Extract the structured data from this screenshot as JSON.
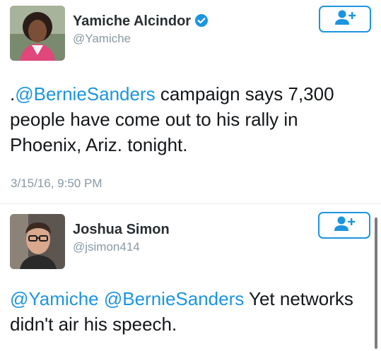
{
  "tweets": [
    {
      "author_name": "Yamiche Alcindor",
      "author_handle": "@Yamiche",
      "verified": true,
      "text_parts": [
        {
          "type": "text",
          "value": "."
        },
        {
          "type": "mention",
          "value": "@BernieSanders"
        },
        {
          "type": "text",
          "value": " campaign says 7,300 people have come out to his rally in Phoenix, Ariz. tonight."
        }
      ],
      "timestamp": "3/15/16, 9:50 PM"
    },
    {
      "author_name": "Joshua Simon",
      "author_handle": "@jsimon414",
      "verified": false,
      "text_parts": [
        {
          "type": "mention",
          "value": "@Yamiche"
        },
        {
          "type": "text",
          "value": " "
        },
        {
          "type": "mention",
          "value": "@BernieSanders"
        },
        {
          "type": "text",
          "value": " Yet networks didn't air his speech."
        }
      ]
    }
  ],
  "colors": {
    "accent": "#1b95e0",
    "name": "#292f33",
    "meta": "#8899a6",
    "text": "#14171a"
  },
  "icons": {
    "follow": "follow-user-icon",
    "verified": "verified-badge-icon"
  }
}
